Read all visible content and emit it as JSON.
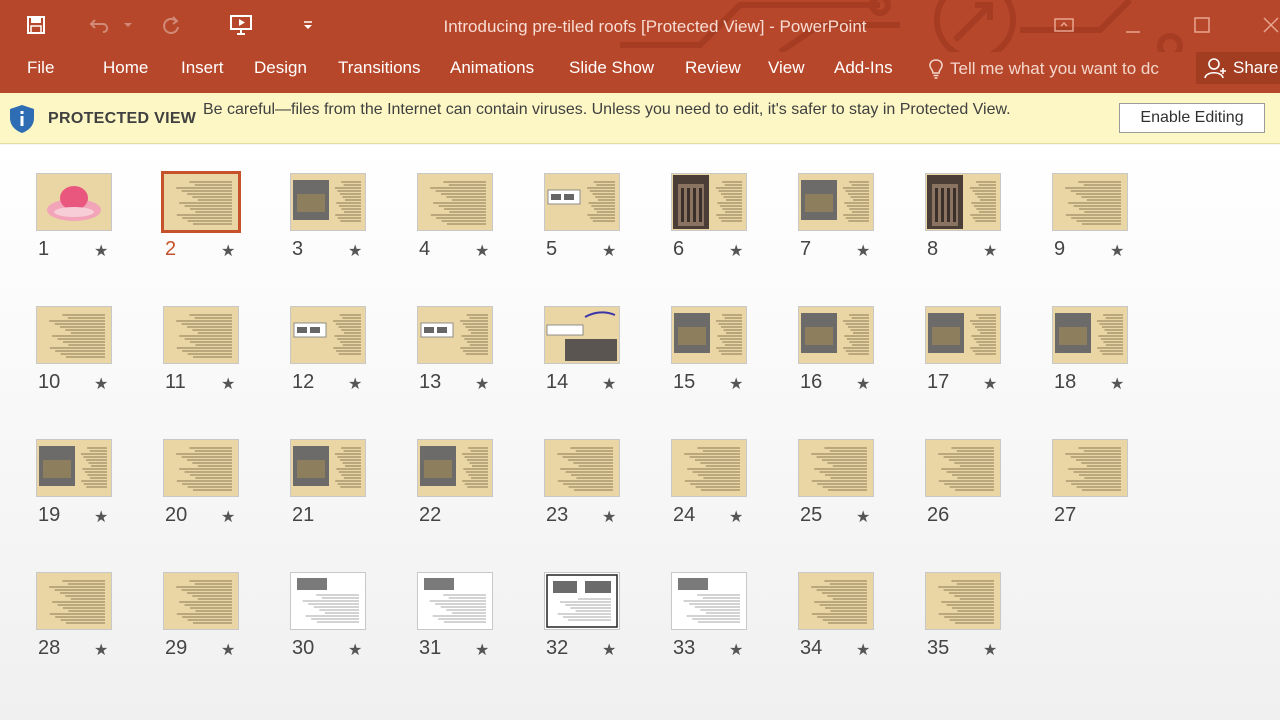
{
  "window": {
    "title": "Introducing pre-tiled roofs [Protected View] - PowerPoint"
  },
  "ribbon": {
    "tabs": [
      "File",
      "Home",
      "Insert",
      "Design",
      "Transitions",
      "Animations",
      "Slide Show",
      "Review",
      "View",
      "Add-Ins"
    ],
    "tell_me_placeholder": "Tell me what you want to dc",
    "share_label": "Share"
  },
  "protected_view": {
    "title": "PROTECTED VIEW",
    "message": "Be careful—files from the Internet can contain viruses. Unless you need to edit, it's safer to stay in Protected View.",
    "button_label": "Enable Editing"
  },
  "colors": {
    "ribbon": "#b7472a",
    "banner": "#fcf7c5",
    "selection": "#c6522b"
  },
  "slides": [
    {
      "number": "1",
      "star": true,
      "image": "pink-rose-decoration"
    },
    {
      "number": "2",
      "star": true,
      "selected": true,
      "image": "text"
    },
    {
      "number": "3",
      "star": true,
      "image": "photo-text"
    },
    {
      "number": "4",
      "star": true,
      "image": "text"
    },
    {
      "number": "5",
      "star": true,
      "image": "diagram-text"
    },
    {
      "number": "6",
      "star": true,
      "image": "building-photo-text"
    },
    {
      "number": "7",
      "star": true,
      "image": "photo-text"
    },
    {
      "number": "8",
      "star": true,
      "image": "building-photo-text"
    },
    {
      "number": "9",
      "star": true,
      "image": "text"
    },
    {
      "number": "10",
      "star": true,
      "image": "text"
    },
    {
      "number": "11",
      "star": true,
      "image": "text"
    },
    {
      "number": "12",
      "star": true,
      "image": "diagram-text"
    },
    {
      "number": "13",
      "star": true,
      "image": "diagram-text"
    },
    {
      "number": "14",
      "star": true,
      "image": "diagram-photo"
    },
    {
      "number": "15",
      "star": true,
      "image": "photo-text"
    },
    {
      "number": "16",
      "star": true,
      "image": "photo-text"
    },
    {
      "number": "17",
      "star": true,
      "image": "photo-text"
    },
    {
      "number": "18",
      "star": true,
      "image": "photo-text"
    },
    {
      "number": "19",
      "star": true,
      "image": "photo-text"
    },
    {
      "number": "20",
      "star": true,
      "image": "text"
    },
    {
      "number": "21",
      "star": false,
      "image": "photo-text"
    },
    {
      "number": "22",
      "star": false,
      "image": "photo-text"
    },
    {
      "number": "23",
      "star": true,
      "image": "text"
    },
    {
      "number": "24",
      "star": true,
      "image": "text"
    },
    {
      "number": "25",
      "star": true,
      "image": "text"
    },
    {
      "number": "26",
      "star": false,
      "image": "text"
    },
    {
      "number": "27",
      "star": false,
      "image": "text"
    },
    {
      "number": "28",
      "star": true,
      "image": "text"
    },
    {
      "number": "29",
      "star": true,
      "image": "text"
    },
    {
      "number": "30",
      "star": true,
      "image": "white-document"
    },
    {
      "number": "31",
      "star": true,
      "image": "white-document"
    },
    {
      "number": "32",
      "star": true,
      "image": "white-document-framed"
    },
    {
      "number": "33",
      "star": true,
      "image": "white-document"
    },
    {
      "number": "34",
      "star": true,
      "image": "text"
    },
    {
      "number": "35",
      "star": true,
      "image": "text"
    }
  ]
}
